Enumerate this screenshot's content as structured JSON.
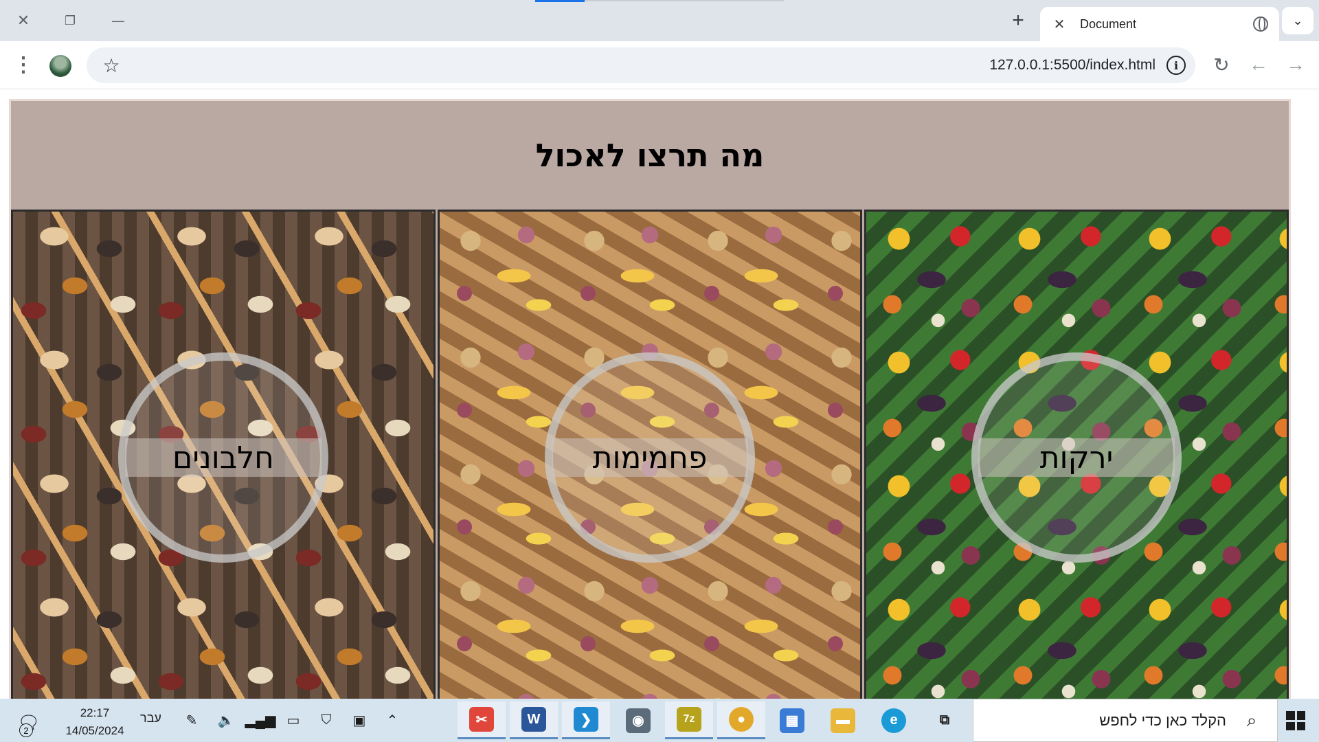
{
  "browser": {
    "tab_title": "Document",
    "tab_close": "✕",
    "new_tab": "+",
    "tab_search": "⌄",
    "window_controls": {
      "close": "✕",
      "restore": "❐",
      "minimize": "—"
    },
    "url": "127.0.0.1:5500/index.html",
    "toolbar": {
      "menu": "⋮",
      "star": "☆",
      "info": "i",
      "reload": "↻",
      "back": "←",
      "forward": "→"
    }
  },
  "page": {
    "title": "מה תרצו לאכול",
    "cards": [
      {
        "label": "חלבונים"
      },
      {
        "label": "פחמימות"
      },
      {
        "label": "ירקות"
      }
    ]
  },
  "taskbar": {
    "notification_count": "2",
    "time": "22:17",
    "date": "14/05/2024",
    "language": "עבר",
    "search_placeholder": "הקלד כאן כדי לחפש",
    "apps": [
      {
        "name": "snipping-tool",
        "glyph": "✂",
        "color": "#e0463a"
      },
      {
        "name": "word",
        "glyph": "W",
        "color": "#2b579a"
      },
      {
        "name": "vscode",
        "glyph": "❯",
        "color": "#1f8ad2"
      },
      {
        "name": "camera",
        "glyph": "◉",
        "color": "#5c6b7a"
      },
      {
        "name": "7zip",
        "glyph": "7z",
        "color": "#b7a21b"
      },
      {
        "name": "chrome",
        "glyph": "●",
        "color": "#e2a82a"
      },
      {
        "name": "store",
        "glyph": "▦",
        "color": "#3a7bd5"
      },
      {
        "name": "file-explorer",
        "glyph": "▬",
        "color": "#e9b73a"
      },
      {
        "name": "edge",
        "glyph": "e",
        "color": "#1a9ad6"
      },
      {
        "name": "task-view",
        "glyph": "⧉",
        "color": "#8a949e"
      }
    ]
  }
}
